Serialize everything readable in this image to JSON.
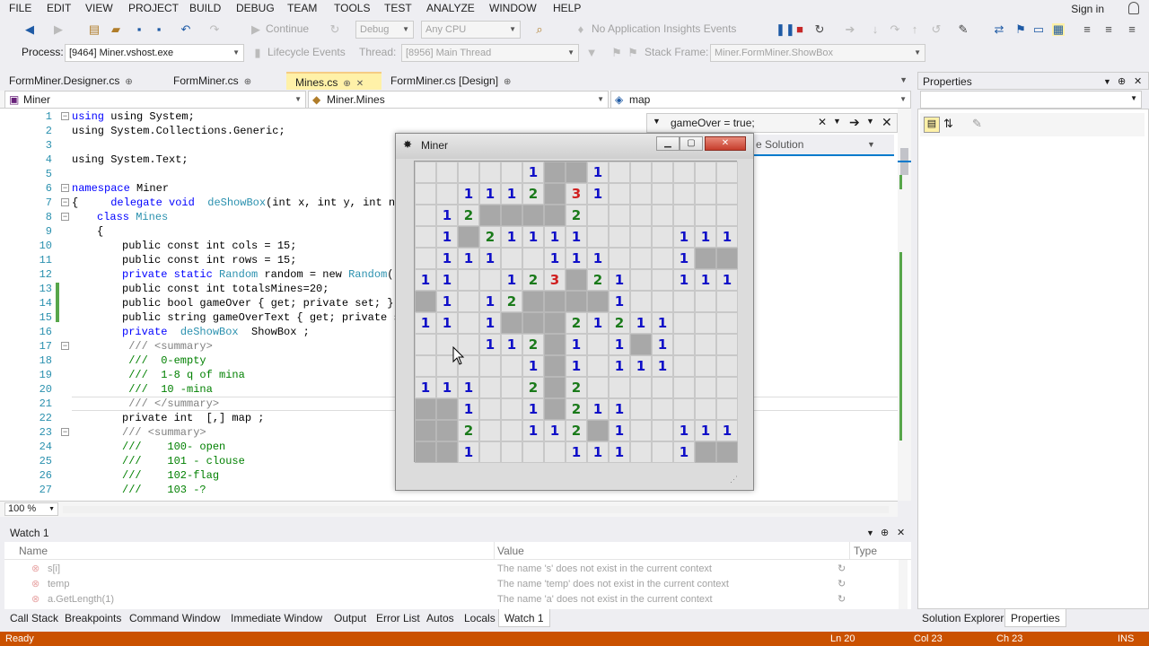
{
  "menu": [
    "FILE",
    "EDIT",
    "VIEW",
    "PROJECT",
    "BUILD",
    "DEBUG",
    "TEAM",
    "TOOLS",
    "TEST",
    "ANALYZE",
    "WINDOW",
    "HELP"
  ],
  "sign_in": "Sign in",
  "toolbar": {
    "continue": "Continue",
    "config": "Debug",
    "platform": "Any CPU",
    "insights": "No Application Insights Events"
  },
  "toolbar2": {
    "process_label": "Process:",
    "process_value": "[9464] Miner.vshost.exe",
    "lifecycle": "Lifecycle Events",
    "thread_label": "Thread:",
    "thread_value": "[8956] Main Thread",
    "stack_label": "Stack Frame:",
    "stack_value": "Miner.FormMiner.ShowBox"
  },
  "doc_tabs": [
    "FormMiner.Designer.cs",
    "FormMiner.cs",
    "Mines.cs",
    "FormMiner.cs [Design]"
  ],
  "nav": {
    "project": "Miner",
    "type": "Miner.Mines",
    "member": "map"
  },
  "find_text": "gameOver = true;",
  "solution_hint": "e Solution",
  "zoom": "100 %",
  "code": {
    "line_numbers": [
      "1",
      "2",
      "3",
      "4",
      "5",
      "6",
      "7",
      "8",
      "9",
      "10",
      "11",
      "12",
      "13",
      "14",
      "15",
      "16",
      "17",
      "18",
      "19",
      "20",
      "21",
      "22",
      "23",
      "24",
      "25",
      "26",
      "27"
    ],
    "l1": "using System;",
    "l2": "using System.Collections.Generic;",
    "l4": "using System.Text;",
    "l6_ns": "namespace",
    "l6_name": " Miner",
    "l7_a": "{     ",
    "l7_delegate": "delegate",
    "l7_void": " void",
    "l7_name": "  deShowBox",
    "l7_rest": "(int x, int y, int num",
    "l8_class": "class",
    "l8_name": " Mines",
    "l9": "{",
    "l10": "public const int cols = 15;",
    "l11": "public const int rows = 15;",
    "l12_a": "private static ",
    "l12_type": "Random",
    "l12_b": " random = new ",
    "l12_type2": "Random",
    "l12_c": "();",
    "l13": "public const int totalsMines=20;",
    "l14": "public bool gameOver { get; private set; }",
    "l15": "public string gameOverText { get; private set",
    "l16_a": "private  ",
    "l16_type": "deShowBox",
    "l16_b": "  ShowBox ;",
    "l17": " /// <summary>",
    "l18": " ///  0-empty",
    "l19": " ///  1-8 q of mina",
    "l20": " ///  10 -mina",
    "l21": " /// </summary>",
    "l22": "private int  [,] map ;",
    "l23": "/// <summary>",
    "l24": "///    100- open",
    "l25": "///    101 - clouse",
    "l26": "///    102-flag",
    "l27": "///    103 -?"
  },
  "miner": {
    "title": "Miner",
    "grid": [
      [
        "o",
        "o",
        "o",
        "o",
        "o",
        "1",
        "c",
        "c",
        "1",
        "o",
        "o",
        "o",
        "o",
        "o",
        "o"
      ],
      [
        "o",
        "o",
        "1",
        "1",
        "1",
        "2",
        "c",
        "3",
        "1",
        "o",
        "o",
        "o",
        "o",
        "o",
        "o"
      ],
      [
        "o",
        "1",
        "2",
        "c",
        "c",
        "c",
        "c",
        "2",
        "o",
        "o",
        "o",
        "o",
        "o",
        "o",
        "o"
      ],
      [
        "o",
        "1",
        "c",
        "2",
        "1",
        "1",
        "1",
        "1",
        "o",
        "o",
        "o",
        "o",
        "1",
        "1",
        "1"
      ],
      [
        "o",
        "1",
        "1",
        "1",
        "o",
        "o",
        "1",
        "1",
        "1",
        "o",
        "o",
        "o",
        "1",
        "c",
        "c"
      ],
      [
        "1",
        "1",
        "o",
        "o",
        "1",
        "2",
        "3",
        "c",
        "2",
        "1",
        "o",
        "o",
        "1",
        "1",
        "1"
      ],
      [
        "c",
        "1",
        "o",
        "1",
        "2",
        "c",
        "c",
        "c",
        "c",
        "1",
        "o",
        "o",
        "o",
        "o",
        "o"
      ],
      [
        "1",
        "1",
        "o",
        "1",
        "c",
        "c",
        "c",
        "2",
        "1",
        "2",
        "1",
        "1",
        "o",
        "o",
        "o"
      ],
      [
        "o",
        "o",
        "o",
        "1",
        "1",
        "2",
        "c",
        "1",
        "o",
        "1",
        "c",
        "1",
        "o",
        "o",
        "o"
      ],
      [
        "o",
        "o",
        "o",
        "o",
        "o",
        "1",
        "c",
        "1",
        "o",
        "1",
        "1",
        "1",
        "o",
        "o",
        "o"
      ],
      [
        "1",
        "1",
        "1",
        "o",
        "o",
        "2",
        "c",
        "2",
        "o",
        "o",
        "o",
        "o",
        "o",
        "o",
        "o"
      ],
      [
        "c",
        "c",
        "1",
        "o",
        "o",
        "1",
        "c",
        "2",
        "1",
        "1",
        "o",
        "o",
        "o",
        "o",
        "o"
      ],
      [
        "c",
        "c",
        "2",
        "o",
        "o",
        "1",
        "1",
        "2",
        "c",
        "1",
        "o",
        "o",
        "1",
        "1",
        "1"
      ],
      [
        "c",
        "c",
        "1",
        "o",
        "o",
        "o",
        "o",
        "1",
        "1",
        "1",
        "o",
        "o",
        "1",
        "c",
        "c"
      ]
    ]
  },
  "properties": {
    "title": "Properties"
  },
  "watch": {
    "title": "Watch 1",
    "col_name": "Name",
    "col_value": "Value",
    "col_type": "Type",
    "rows": [
      {
        "name": "s[i]",
        "value": "The name 's' does not exist in the current context"
      },
      {
        "name": "temp",
        "value": "The name 'temp' does not exist in the current context"
      },
      {
        "name": "a.GetLength(1)",
        "value": "The name 'a' does not exist in the current context"
      }
    ]
  },
  "bottom_tabs": [
    "Call Stack",
    "Breakpoints",
    "Command Window",
    "Immediate Window",
    "Output",
    "Error List",
    "Autos",
    "Locals",
    "Watch 1"
  ],
  "right_tabs": [
    "Solution Explorer",
    "Properties"
  ],
  "status": {
    "ready": "Ready",
    "ln": "Ln 20",
    "col": "Col 23",
    "ch": "Ch 23",
    "ins": "INS"
  },
  "colors": {
    "status_bg": "#ca5100",
    "accent": "#007acc"
  }
}
